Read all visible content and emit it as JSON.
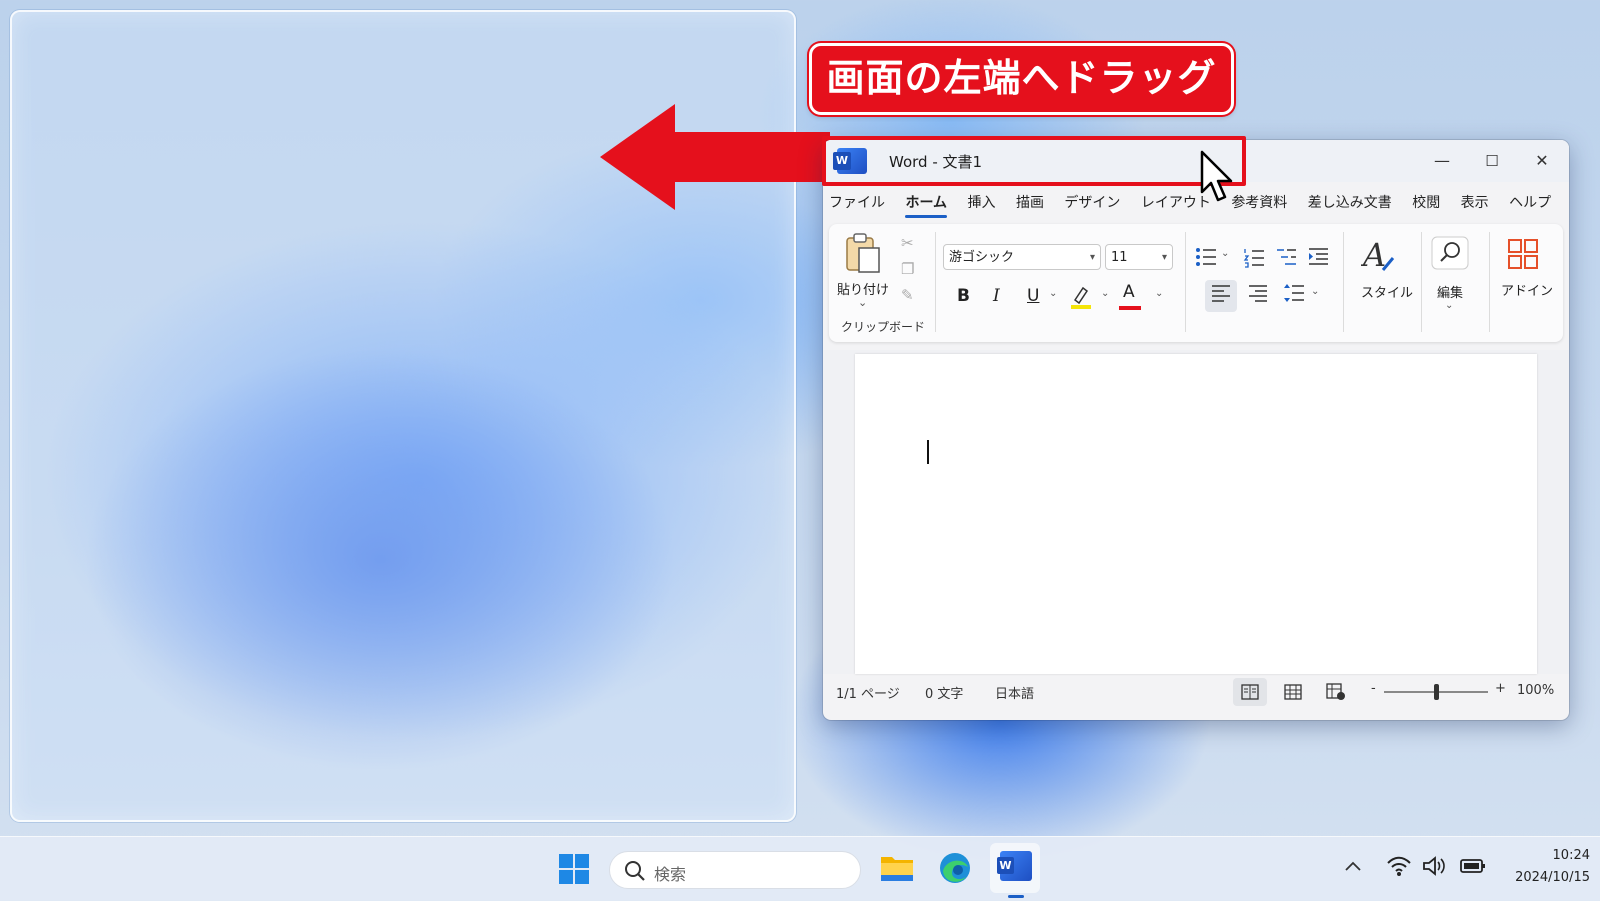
{
  "annotation": {
    "callout": "画面の左端へドラッグ",
    "accent_color": "#e5101c"
  },
  "window": {
    "title": "Word - 文書1",
    "app_icon": "word-icon",
    "minimize": "—",
    "maximize": "☐",
    "close": "✕"
  },
  "menu": {
    "items": [
      "ファイル",
      "ホーム",
      "挿入",
      "描画",
      "デザイン",
      "レイアウト",
      "参考資料",
      "差し込み文書",
      "校閲",
      "表示",
      "ヘルプ"
    ],
    "active": "ホーム"
  },
  "ribbon": {
    "paste_label": "貼り付け",
    "clipboard_group": "クリップボード",
    "font_name": "游ゴシック",
    "font_size": "11",
    "bold": "B",
    "italic": "I",
    "underline": "U",
    "font_color_letter": "A",
    "style_label": "スタイル",
    "edit_label": "編集",
    "addin_label": "アドイン"
  },
  "status": {
    "page": "1/1 ページ",
    "words": "0 文字",
    "language": "日本語",
    "zoom_minus": "-",
    "zoom_plus": "+",
    "zoom": "100%",
    "zoom_level": 0.5
  },
  "taskbar": {
    "search_placeholder": "検索",
    "apps": [
      "windows-start-icon",
      "file-explorer-icon",
      "edge-icon",
      "word-icon"
    ],
    "tray": [
      "chevron-up-icon",
      "wifi-icon",
      "volume-icon",
      "battery-icon"
    ],
    "time": "10:24",
    "date": "2024/10/15"
  }
}
